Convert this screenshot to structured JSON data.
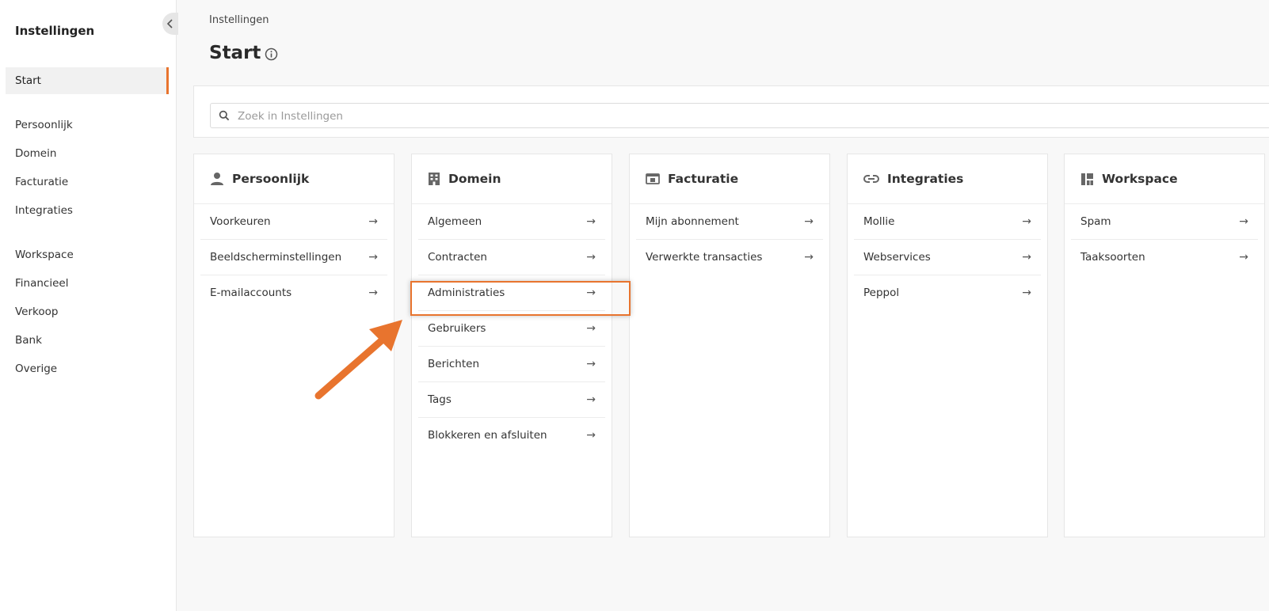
{
  "sidebar": {
    "title": "Instellingen",
    "items": [
      {
        "label": "Start",
        "active": true
      },
      {
        "label": "Persoonlijk"
      },
      {
        "label": "Domein"
      },
      {
        "label": "Facturatie"
      },
      {
        "label": "Integraties"
      },
      {
        "label": "Workspace"
      },
      {
        "label": "Financieel"
      },
      {
        "label": "Verkoop"
      },
      {
        "label": "Bank"
      },
      {
        "label": "Overige"
      }
    ]
  },
  "header": {
    "breadcrumb": "Instellingen",
    "title": "Start"
  },
  "search": {
    "placeholder": "Zoek in Instellingen"
  },
  "cards": [
    {
      "title": "Persoonlijk",
      "icon": "person-icon",
      "items": [
        "Voorkeuren",
        "Beeldscherminstellingen",
        "E-mailaccounts"
      ]
    },
    {
      "title": "Domein",
      "icon": "building-icon",
      "items": [
        "Algemeen",
        "Contracten",
        "Administraties",
        "Gebruikers",
        "Berichten",
        "Tags",
        "Blokkeren en afsluiten"
      ]
    },
    {
      "title": "Facturatie",
      "icon": "billing-icon",
      "items": [
        "Mijn abonnement",
        "Verwerkte transacties"
      ]
    },
    {
      "title": "Integraties",
      "icon": "link-icon",
      "items": [
        "Mollie",
        "Webservices",
        "Peppol"
      ]
    },
    {
      "title": "Workspace",
      "icon": "dashboard-icon",
      "items": [
        "Spam",
        "Taaksoorten"
      ]
    }
  ],
  "arrow_symbol": "→",
  "colors": {
    "accent": "#e8742e"
  }
}
